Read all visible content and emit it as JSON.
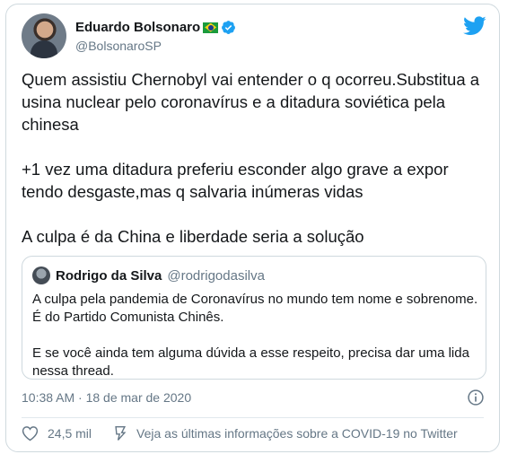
{
  "author": {
    "name": "Eduardo Bolsonaro",
    "handle": "@BolsonaroSP"
  },
  "tweet": {
    "text": "Quem assistiu Chernobyl vai entender o q ocorreu.Substitua a\nusina nuclear pelo coronavírus e a ditadura soviética pela\nchinesa\n\n+1 vez uma ditadura preferiu esconder algo grave a expor\ntendo desgaste,mas q salvaria inúmeras vidas\n\nA culpa é da China e liberdade seria a solução"
  },
  "quoted": {
    "name": "Rodrigo da Silva",
    "handle": "@rodrigodasilva",
    "text": "A culpa pela pandemia de Coronavírus no mundo tem nome e sobrenome.\nÉ do Partido Comunista Chinês.\n\nE se você ainda tem alguma dúvida a esse respeito, precisa dar uma lida\nnessa thread."
  },
  "meta": {
    "timestamp": "10:38 AM · 18 de mar de 2020"
  },
  "actions": {
    "likes": "24,5 mil",
    "covid_link": "Veja as últimas informações sobre a COVID-19 no Twitter"
  },
  "colors": {
    "twitter_blue": "#1da1f2",
    "secondary_text": "#657786",
    "flag_green": "#1b9b3c",
    "flag_yellow": "#f7d117"
  },
  "icons": [
    "twitter-bird-icon",
    "verified-badge-icon",
    "brazil-flag-icon",
    "info-icon",
    "heart-icon",
    "covid-info-icon"
  ]
}
